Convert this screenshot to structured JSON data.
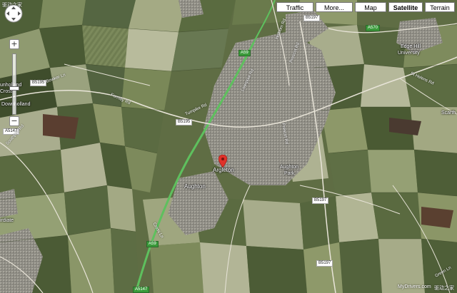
{
  "map_types": [
    {
      "label": "Traffic",
      "active": false
    },
    {
      "label": "More...",
      "active": false
    },
    {
      "label": "Map",
      "active": false
    },
    {
      "label": "Satellite",
      "active": true
    },
    {
      "label": "Terrain",
      "active": false
    }
  ],
  "zoom": {
    "level_fraction": 0.57
  },
  "marker": {
    "label": "Argleton",
    "color": "#e0322a"
  },
  "places": {
    "aughton": "Aughton",
    "aughton_park_1": "Aughton",
    "aughton_park_2": "Park",
    "edge_hill_1": "Edge Hill",
    "edge_hill_2": "University",
    "scarth": "Scarth",
    "left_cross": "unholland",
    "left_cross_2": "Cross",
    "down_holland": "Downholland",
    "ordiate": "irdiate"
  },
  "roads": {
    "b5195_left": "B5195",
    "b5195_top": "B5195",
    "b5195_mid": "B5195",
    "b5197_top": "B5197",
    "b5197_right": "B5197",
    "b5197_bottom": "B5197",
    "a5147": "A5147",
    "a59_top": "A59",
    "a59_bottom": "A59",
    "a570": "A570",
    "a5147_bottom": "A5147"
  },
  "streets": {
    "holborn": "Holborn Rd",
    "prescot": "Prescot Rd",
    "bowker": "Bowker Ln",
    "turnpike": "Turnpike Rd",
    "liverpool": "Liverpool Rd",
    "prescott2": "Prescot Rd",
    "st_helens": "St Helens Rd",
    "formby": "Formby Rd",
    "cross": "Cross Ln",
    "southport": "Southport Rd",
    "green_ln": "Green Ln"
  },
  "watermarks": {
    "top_left": "驱动之家",
    "bottom_right_1": "MyDrivers.com",
    "bottom_right_2": "驱动之家"
  },
  "colors": {
    "field_dark": "#4a5a34",
    "field_light": "#8a9a6a",
    "field_pale": "#b4b89a",
    "urban": "#9a9890",
    "motorway": "#5ec05e"
  }
}
